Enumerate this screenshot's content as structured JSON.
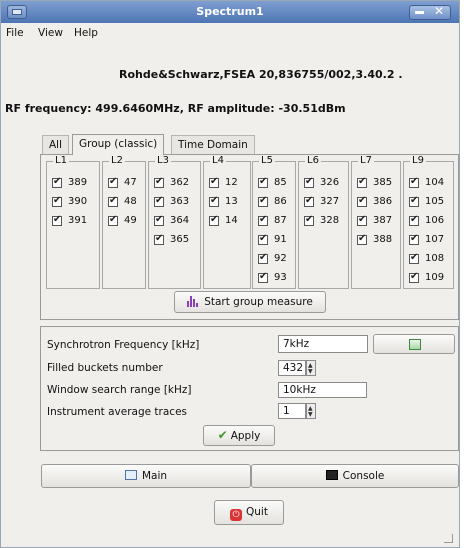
{
  "window": {
    "title": "Spectrum1"
  },
  "menubar": {
    "file": "File",
    "view": "View",
    "help": "Help"
  },
  "device_info": "Rohde&Schwarz,FSEA 20,836755/002,3.40.2 .",
  "rf_status": "RF frequency: 499.6460MHz, RF amplitude: -30.51dBm",
  "tabs": [
    {
      "label": "All",
      "active": false
    },
    {
      "label": "Group (classic)",
      "active": true
    },
    {
      "label": "Time Domain",
      "active": false
    }
  ],
  "groups": [
    {
      "title": "L1",
      "items": [
        "389",
        "390",
        "391"
      ]
    },
    {
      "title": "L2",
      "items": [
        "47",
        "48",
        "49"
      ]
    },
    {
      "title": "L3",
      "items": [
        "362",
        "363",
        "364",
        "365"
      ]
    },
    {
      "title": "L4",
      "items": [
        "12",
        "13",
        "14"
      ]
    },
    {
      "title": "L5",
      "items": [
        "85",
        "86",
        "87",
        "91",
        "92",
        "93"
      ]
    },
    {
      "title": "L6",
      "items": [
        "326",
        "327",
        "328"
      ]
    },
    {
      "title": "L7",
      "items": [
        "385",
        "386",
        "387",
        "388"
      ]
    },
    {
      "title": "L9",
      "items": [
        "104",
        "105",
        "106",
        "107",
        "108",
        "109"
      ]
    }
  ],
  "start_group_measure": "Start group measure",
  "form": {
    "sync_label": "Synchrotron Frequency [kHz]",
    "sync_value": "7kHz",
    "filled_label": "Filled buckets number",
    "filled_value": "432",
    "window_label": "Window search range [kHz]",
    "window_value": "10kHz",
    "avg_label": "Instrument average traces",
    "avg_value": "1",
    "apply": "Apply"
  },
  "buttons": {
    "main": "Main",
    "console": "Console",
    "quit": "Quit"
  }
}
